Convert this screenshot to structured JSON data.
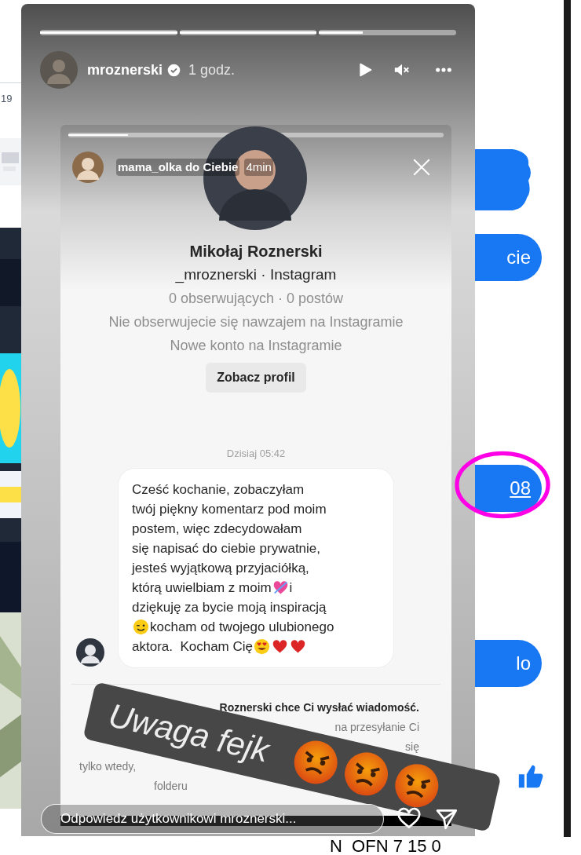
{
  "left_edge": {
    "date_fragment": "19"
  },
  "story": {
    "segments": [
      {
        "level": 1
      },
      {
        "level": 1
      },
      {
        "level": 0.32
      }
    ],
    "username": "mroznerski",
    "verified": true,
    "time": "1 godz.",
    "screenshot": {
      "segments": [
        {
          "level": 0.16
        }
      ],
      "sender": "mama_olka do Ciebie",
      "sender_time": "4min",
      "profile": {
        "name": "Mikołaj Roznerski",
        "handle": "_mroznerski · Instagram",
        "stats": "0 obserwujących · 0 postów",
        "mutual": "Nie obserwujecie się nawzajem na Instagramie",
        "note": "Nowe konto na Instagramie",
        "button": "Zobacz profil"
      },
      "date": "Dzisiaj 05:42",
      "message_lines": [
        [
          {
            "kind": "text",
            "text": "Cześć kochanie, zobaczyłam"
          }
        ],
        [
          {
            "kind": "text",
            "text": "twój piękny komentarz pod moim"
          }
        ],
        [
          {
            "kind": "text",
            "text": "postem, więc zdecydowałam"
          }
        ],
        [
          {
            "kind": "text",
            "text": "się napisać do ciebie prywatnie,"
          }
        ],
        [
          {
            "kind": "text",
            "text": "jesteś wyjątkową przyjaciółką,"
          }
        ],
        [
          {
            "kind": "text",
            "text": "którą uwielbiam z moim"
          },
          {
            "kind": "arrow-heart"
          },
          {
            "kind": "text",
            "text": "i"
          }
        ],
        [
          {
            "kind": "text",
            "text": "dziękuję za bycie moją inspiracją"
          }
        ],
        [
          {
            "kind": "wink"
          },
          {
            "kind": "text",
            "text": "kocham od twojego ulubionego"
          }
        ],
        [
          {
            "kind": "text",
            "text": "aktora.  Kocham Cię"
          },
          {
            "kind": "heart-eyes"
          },
          {
            "kind": "heart"
          },
          {
            "kind": "heart"
          }
        ]
      ],
      "request_title": [
        {
          "text": "Roznerski chce Ci wysłać wiadomość.",
          "kind": "right"
        }
      ],
      "request_lines": [
        [
          {
            "text": "na przesyłanie Ci",
            "kind": "right"
          }
        ],
        [
          {
            "text": "się",
            "kind": "right"
          }
        ],
        [
          {
            "text": "tylko wtedy,",
            "kind": "left"
          }
        ],
        [
          {
            "text": "folderu",
            "kind": "left"
          }
        ]
      ]
    },
    "sticker": {
      "text": "Uwaga fejk",
      "emojis": [
        {
          "kind": "angry"
        },
        {
          "kind": "angry"
        },
        {
          "kind": "angry"
        }
      ]
    },
    "reply": {
      "placeholder": "Odpowiedz użytkownikowi mroznerski..."
    }
  },
  "right_edge": {
    "bubbles": [
      {
        "kind": "blob"
      },
      {
        "kind": "text",
        "text": "cie",
        "highlighted": false,
        "link": false
      },
      {
        "kind": "text",
        "text": "08",
        "highlighted": true,
        "link": true
      },
      {
        "kind": "text",
        "text": "lo",
        "highlighted": false,
        "link": false
      }
    ]
  },
  "bottom_caption": "N  OFN 7 15 0"
}
